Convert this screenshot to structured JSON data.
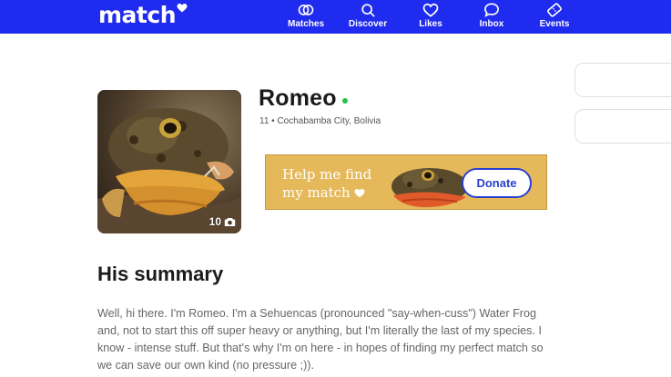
{
  "header": {
    "logo_text": "match",
    "brand_color": "#1f2bee",
    "nav": [
      {
        "label": "Matches",
        "icon": "matches-rings-icon"
      },
      {
        "label": "Discover",
        "icon": "search-icon"
      },
      {
        "label": "Likes",
        "icon": "heart-icon"
      },
      {
        "label": "Inbox",
        "icon": "chat-bubble-icon"
      },
      {
        "label": "Events",
        "icon": "ticket-icon"
      }
    ]
  },
  "profile": {
    "name": "Romeo",
    "online_color": "#22c24a",
    "meta": "11 • Cochabamba City, Bolivia",
    "photo_count": "10"
  },
  "banner": {
    "line1": "Help me find",
    "line2": "my match",
    "donate_label": "Donate",
    "background": "#e5b85a"
  },
  "summary": {
    "title": "His summary",
    "text": "Well, hi there. I'm Romeo. I'm a Sehuencas (pronounced \"say-when-cuss\") Water Frog and, not to start this off super heavy or anything, but I'm literally the last of my species. I know - intense stuff. But that's why I'm on here - in hopes of finding my perfect match so we can save our own kind (no pressure ;))."
  }
}
